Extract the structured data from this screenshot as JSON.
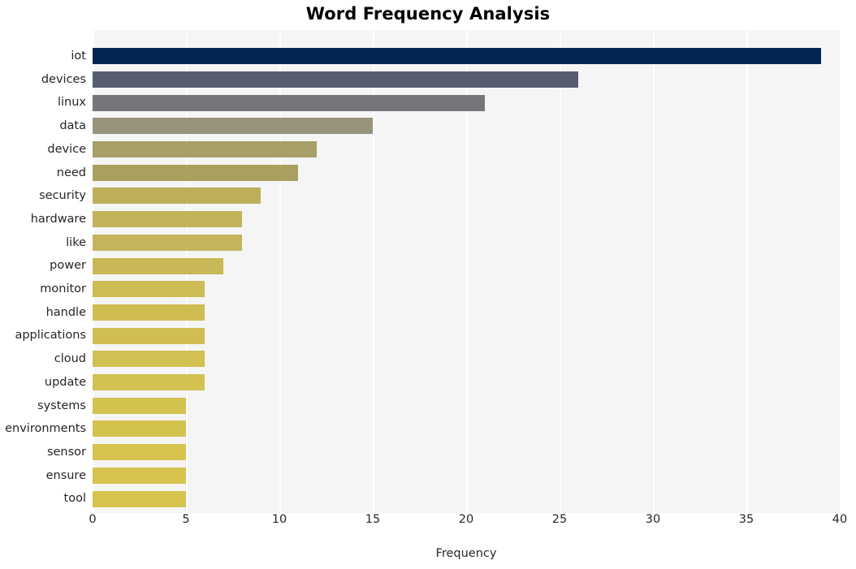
{
  "chart_data": {
    "type": "bar",
    "orientation": "horizontal",
    "title": "Word Frequency Analysis",
    "xlabel": "Frequency",
    "ylabel": "",
    "xlim": [
      0,
      40
    ],
    "xticks": [
      0,
      5,
      10,
      15,
      20,
      25,
      30,
      35,
      40
    ],
    "xtick_labels": [
      "0",
      "5",
      "10",
      "15",
      "20",
      "25",
      "30",
      "35",
      "40"
    ],
    "grid": true,
    "grid_axis": "x",
    "legend": null,
    "background": "#f5f5f6",
    "gridline_color": "#ffffff",
    "categories": [
      "iot",
      "devices",
      "linux",
      "data",
      "device",
      "need",
      "security",
      "hardware",
      "like",
      "power",
      "monitor",
      "handle",
      "applications",
      "cloud",
      "update",
      "systems",
      "environments",
      "sensor",
      "ensure",
      "tool"
    ],
    "values": [
      39,
      26,
      21,
      15,
      12,
      11,
      9,
      8,
      8,
      7,
      6,
      6,
      6,
      6,
      6,
      5,
      5,
      5,
      5,
      5
    ],
    "bar_colors": [
      "#032551",
      "#565d70",
      "#757679",
      "#98937d",
      "#a99f68",
      "#ab9f5d",
      "#bdae5b",
      "#c2b25a",
      "#c4b45c",
      "#c8b857",
      "#cdbb53",
      "#cfbd52",
      "#d0be52",
      "#d2c052",
      "#d3c151",
      "#d4c24f",
      "#d4c24f",
      "#d5c34e",
      "#d5c34e",
      "#d5c34e"
    ]
  }
}
